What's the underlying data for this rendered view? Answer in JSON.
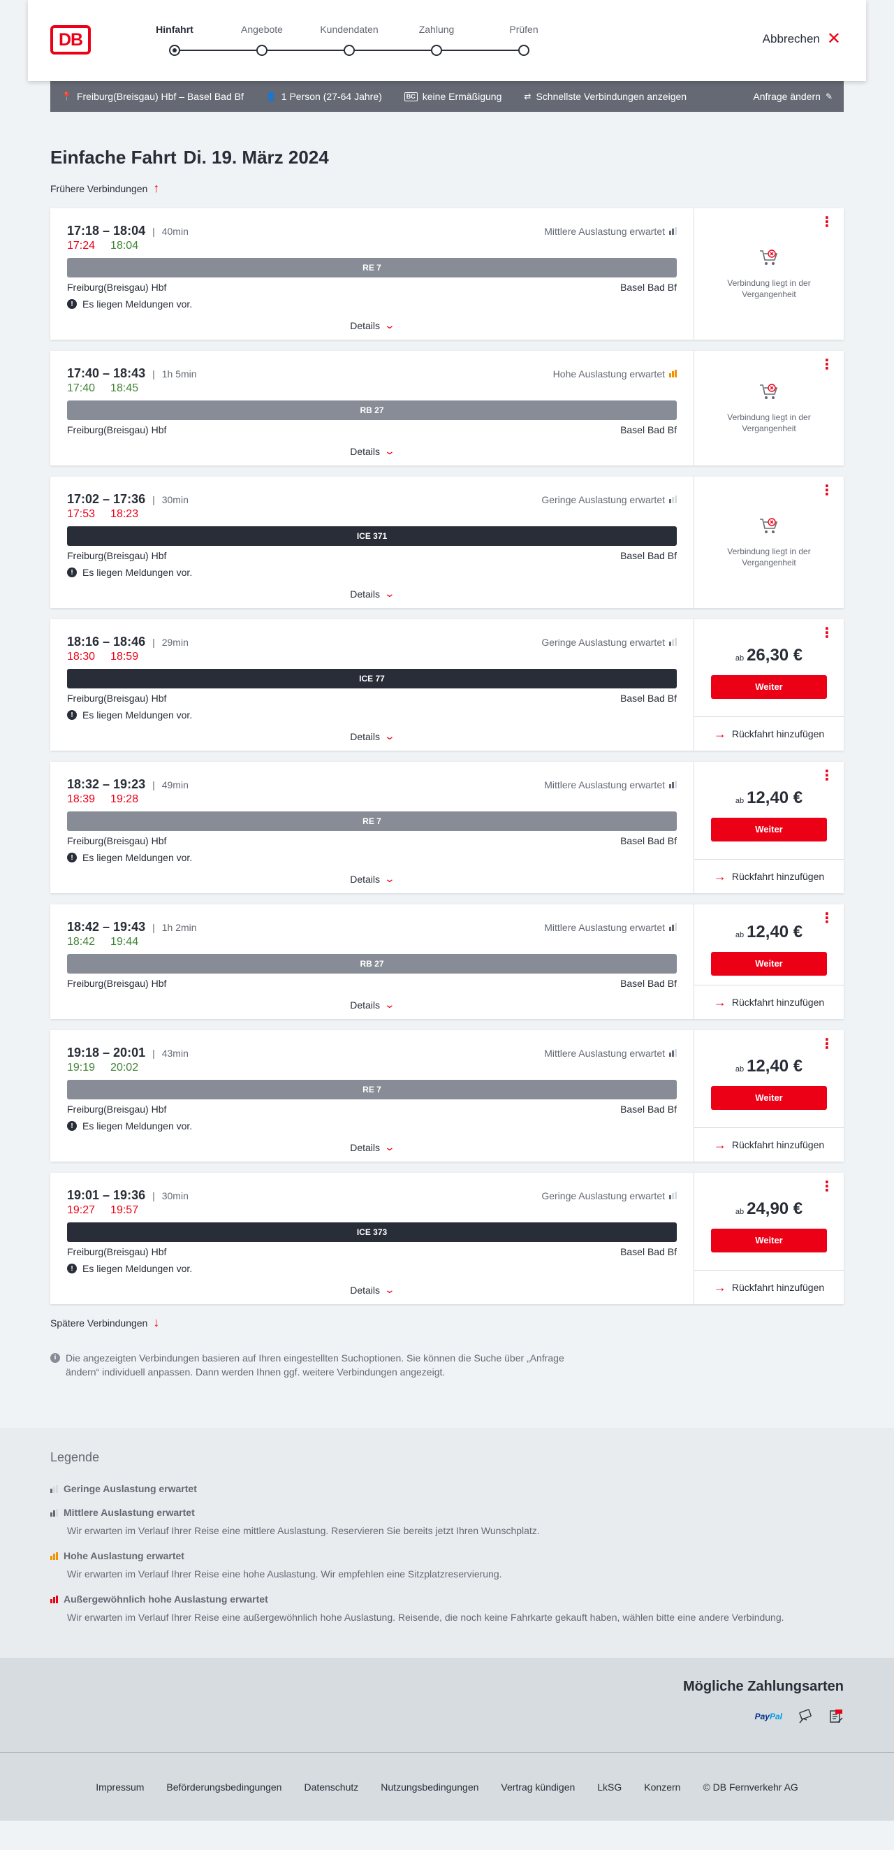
{
  "header": {
    "logo": "DB",
    "steps": [
      "Hinfahrt",
      "Angebote",
      "Kundendaten",
      "Zahlung",
      "Prüfen"
    ],
    "cancel": "Abbrechen"
  },
  "summary": {
    "route": "Freiburg(Breisgau) Hbf – Basel Bad Bf",
    "persons": "1 Person (27-64 Jahre)",
    "bahncard_icon": "BC",
    "discount": "keine Ermäßigung",
    "fastest": "Schnellste Verbindungen anzeigen",
    "change": "Anfrage ändern"
  },
  "title": {
    "main": "Einfache Fahrt",
    "date": "Di. 19. März 2024"
  },
  "earlier": "Frühere Verbindungen",
  "later": "Spätere Verbindungen",
  "labels": {
    "details": "Details",
    "past": "Verbindung liegt in der Vergangenheit",
    "ab": "ab",
    "weiter": "Weiter",
    "return": "Rückfahrt hinzufügen",
    "notice": "Es liegen Meldungen vor."
  },
  "connections": [
    {
      "times": "17:18 – 18:04",
      "duration": "40min",
      "load": "Mittlere Auslastung erwartet",
      "load_level": 2,
      "rt_dep": "17:24",
      "rt_dep_status": "late",
      "rt_arr": "18:04",
      "rt_arr_status": "ok",
      "train": "RE 7",
      "train_type": "regional",
      "from": "Freiburg(Breisgau) Hbf",
      "to": "Basel Bad Bf",
      "notice": true,
      "past": true,
      "price": ""
    },
    {
      "times": "17:40 – 18:43",
      "duration": "1h 5min",
      "load": "Hohe Auslastung erwartet",
      "load_level": 3,
      "rt_dep": "17:40",
      "rt_dep_status": "ok",
      "rt_arr": "18:45",
      "rt_arr_status": "ok",
      "train": "RB 27",
      "train_type": "regional",
      "from": "Freiburg(Breisgau) Hbf",
      "to": "Basel Bad Bf",
      "notice": false,
      "past": true,
      "price": ""
    },
    {
      "times": "17:02 – 17:36",
      "duration": "30min",
      "load": "Geringe Auslastung erwartet",
      "load_level": 1,
      "rt_dep": "17:53",
      "rt_dep_status": "late",
      "rt_arr": "18:23",
      "rt_arr_status": "late",
      "train": "ICE 371",
      "train_type": "ice",
      "from": "Freiburg(Breisgau) Hbf",
      "to": "Basel Bad Bf",
      "notice": true,
      "past": true,
      "price": ""
    },
    {
      "times": "18:16 – 18:46",
      "duration": "29min",
      "load": "Geringe Auslastung erwartet",
      "load_level": 1,
      "rt_dep": "18:30",
      "rt_dep_status": "late",
      "rt_arr": "18:59",
      "rt_arr_status": "late",
      "train": "ICE 77",
      "train_type": "ice",
      "from": "Freiburg(Breisgau) Hbf",
      "to": "Basel Bad Bf",
      "notice": true,
      "past": false,
      "price": "26,30 €"
    },
    {
      "times": "18:32 – 19:23",
      "duration": "49min",
      "load": "Mittlere Auslastung erwartet",
      "load_level": 2,
      "rt_dep": "18:39",
      "rt_dep_status": "late",
      "rt_arr": "19:28",
      "rt_arr_status": "late",
      "train": "RE 7",
      "train_type": "regional",
      "from": "Freiburg(Breisgau) Hbf",
      "to": "Basel Bad Bf",
      "notice": true,
      "past": false,
      "price": "12,40 €"
    },
    {
      "times": "18:42 – 19:43",
      "duration": "1h 2min",
      "load": "Mittlere Auslastung erwartet",
      "load_level": 2,
      "rt_dep": "18:42",
      "rt_dep_status": "ok",
      "rt_arr": "19:44",
      "rt_arr_status": "ok",
      "train": "RB 27",
      "train_type": "regional",
      "from": "Freiburg(Breisgau) Hbf",
      "to": "Basel Bad Bf",
      "notice": false,
      "past": false,
      "price": "12,40 €"
    },
    {
      "times": "19:18 – 20:01",
      "duration": "43min",
      "load": "Mittlere Auslastung erwartet",
      "load_level": 2,
      "rt_dep": "19:19",
      "rt_dep_status": "ok",
      "rt_arr": "20:02",
      "rt_arr_status": "ok",
      "train": "RE 7",
      "train_type": "regional",
      "from": "Freiburg(Breisgau) Hbf",
      "to": "Basel Bad Bf",
      "notice": true,
      "past": false,
      "price": "12,40 €"
    },
    {
      "times": "19:01 – 19:36",
      "duration": "30min",
      "load": "Geringe Auslastung erwartet",
      "load_level": 1,
      "rt_dep": "19:27",
      "rt_dep_status": "late",
      "rt_arr": "19:57",
      "rt_arr_status": "late",
      "train": "ICE 373",
      "train_type": "ice",
      "from": "Freiburg(Breisgau) Hbf",
      "to": "Basel Bad Bf",
      "notice": true,
      "past": false,
      "price": "24,90 €"
    }
  ],
  "info_text": "Die angezeigten Verbindungen basieren auf Ihren eingestellten Suchoptionen. Sie können die Suche über „Anfrage ändern“ individuell anpassen. Dann werden Ihnen ggf. weitere Verbindungen angezeigt.",
  "legend": {
    "title": "Legende",
    "items": [
      {
        "title": "Geringe Auslastung erwartet",
        "text": "",
        "level": 1
      },
      {
        "title": "Mittlere Auslastung erwartet",
        "text": "Wir erwarten im Verlauf Ihrer Reise eine mittlere Auslastung. Reservieren Sie bereits jetzt Ihren Wunschplatz.",
        "level": 2
      },
      {
        "title": "Hohe Auslastung erwartet",
        "text": "Wir erwarten im Verlauf Ihrer Reise eine hohe Auslastung. Wir empfehlen eine Sitzplatzreservierung.",
        "level": 3
      },
      {
        "title": "Außergewöhnlich hohe Auslastung erwartet",
        "text": "Wir erwarten im Verlauf Ihrer Reise eine außergewöhnlich hohe Auslastung. Reisende, die noch keine Fahrkarte gekauft haben, wählen bitte eine andere Verbindung.",
        "level": 4
      }
    ]
  },
  "payment": {
    "title": "Mögliche Zahlungsarten",
    "paypal_a": "Pay",
    "paypal_b": "Pal"
  },
  "footer": [
    "Impressum",
    "Beförderungsbedingungen",
    "Datenschutz",
    "Nutzungsbedingungen",
    "Vertrag kündigen",
    "LkSG",
    "Konzern",
    "© DB Fernverkehr AG"
  ],
  "colors": {
    "db_red": "#ec0016",
    "late": "#ec0016",
    "on_time": "#408335",
    "ice_bar": "#282d37",
    "regional_bar": "#878c96",
    "high_load": "#f39200"
  }
}
